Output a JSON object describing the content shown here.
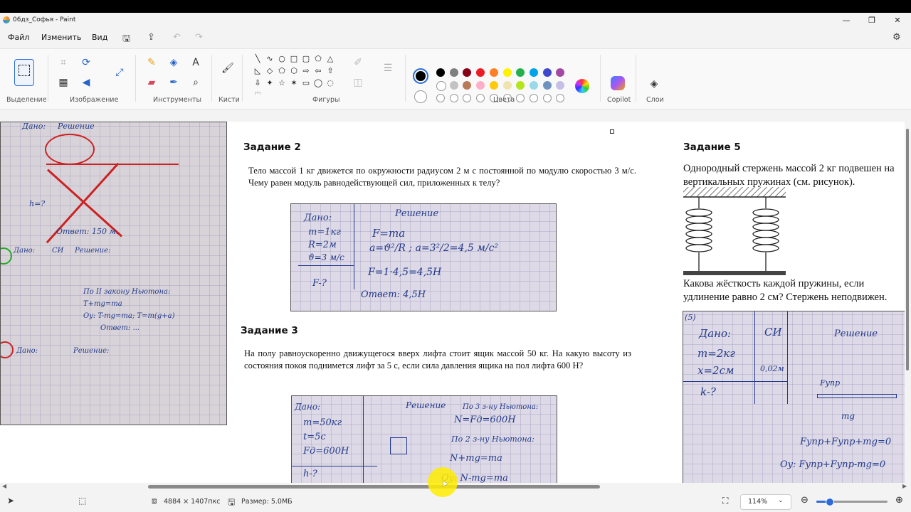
{
  "window": {
    "title": "06дз_Софья - Paint",
    "controls": [
      "—",
      "❐",
      "✕"
    ]
  },
  "menu": {
    "file": "Файл",
    "edit": "Изменить",
    "view": "Вид"
  },
  "ribbon": {
    "groups": {
      "selection": "Выделение",
      "image": "Изображение",
      "tools": "Инструменты",
      "brushes": "Кисти",
      "shapes": "Фигуры",
      "colors": "Цвета",
      "copilot": "Copilot",
      "layers": "Слои"
    },
    "palette_row1": [
      "#000000",
      "#7f7f7f",
      "#880015",
      "#ed1c24",
      "#ff7f27",
      "#fff200",
      "#22b14c",
      "#00a2e8",
      "#3f48cc",
      "#a349a4"
    ],
    "palette_row2": [
      "#ffffff",
      "#c3c3c3",
      "#b97a57",
      "#ffaec9",
      "#ffc90e",
      "#efe4b0",
      "#b5e61d",
      "#99d9ea",
      "#7092be",
      "#c8bfe7"
    ],
    "current_color": "#000000"
  },
  "document": {
    "task2_heading": "Задание 2",
    "task2_text": "Тело массой 1 кг движется по окружности радиусом 2 м с постоянной по модулю скоростью 3 м/с. Чему равен модуль равнодействующей сил, приложенных к телу?",
    "task3_heading": "Задание 3",
    "task3_text": "На полу равноускоренно движущегося вверх лифта стоит ящик массой 50 кг. На какую высоту из состояния покоя поднимется лифт за 5 с, если сила давления ящика на пол лифта 600 Н?",
    "task5_heading": "Задание 5",
    "task5_text1": "Однородный стержень массой 2 кг подвешен на вертикальных пружинах (см. рисунок).",
    "task5_text2": "Какова жёсткость каждой пружины, если удлинение равно 2 см? Стержень неподвижен.",
    "notes2": {
      "l1": "Дано:",
      "l2": "m=1кг",
      "l3": "R=2м",
      "l4": "ϑ=3 м/с",
      "l5": "F-?",
      "r1": "Решение",
      "r2": "F=ma",
      "r3": "a=ϑ²/R ; a=3²/2=4,5 м/с²",
      "r4": "F=1·4,5=4,5Н",
      "r5": "Ответ: 4,5Н"
    },
    "notes3": {
      "l1": "Дано:",
      "l2": "m=50кг",
      "l3": "t=5с",
      "l4": "Fд=600Н",
      "l5": "h-?",
      "r1": "Решение",
      "r2": "По 3 з-ну Ньютона:",
      "r3": "N=Fд=600Н",
      "r4": "По 2 з-ну Ньютона:",
      "r5": "N+mg=ma",
      "r6": "Oy: N-mg=ma"
    },
    "notes5": {
      "l1": "Дано:",
      "l2": "m=2кг",
      "l3": "x=2см",
      "l4": "k-?",
      "si": "СИ",
      "si_val": "0,02м",
      "r1": "Решение",
      "r2": "Fупр",
      "r3": "mg",
      "r4": "Fупр+Fупр+mg=0",
      "r5": "Oy: Fупр+Fупр-mg=0"
    },
    "notes_left": {
      "a": "Дано:",
      "b": "Решение",
      "c": "h=?",
      "d": "Ответ: 150 м.",
      "e": "Дано:",
      "f": "СИ",
      "g": "Решение:",
      "h": "По II закону Ньютона:",
      "i": "T+mg=ma",
      "j": "Oy: T-mg=ma; T=m(g+a)",
      "k": "Ответ: ...",
      "l": "Дано:",
      "m": "Решение:"
    }
  },
  "status": {
    "dimensions": "4884 × 1407пкс",
    "size": "Размер: 5.0МБ",
    "zoom": "114%"
  }
}
